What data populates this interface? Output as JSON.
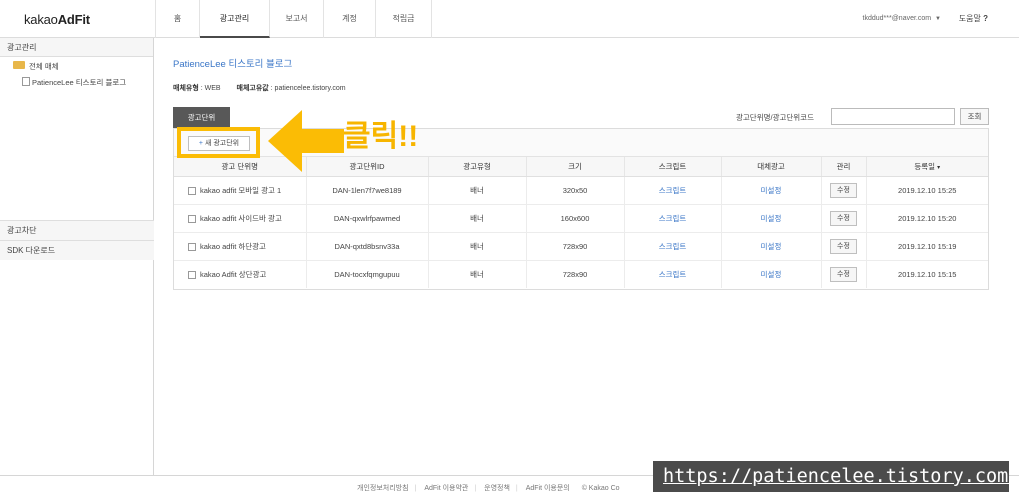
{
  "brand": {
    "prefix": "kakao",
    "name": "AdFit"
  },
  "nav": {
    "items": [
      {
        "label": "홈",
        "active": false
      },
      {
        "label": "광고관리",
        "active": true
      },
      {
        "label": "보고서",
        "active": false
      },
      {
        "label": "계정",
        "active": false
      },
      {
        "label": "적립금",
        "active": false
      }
    ]
  },
  "user": {
    "email": "tkddud***@naver.com",
    "caret": "▼",
    "help_label": "도움말",
    "help_icon": "?"
  },
  "sidebar": {
    "section_title": "광고관리",
    "tree": {
      "root_label": "전체 매체",
      "child_label": "PatienceLee 티스토리 블로그"
    },
    "menu": [
      {
        "label": "광고차단"
      },
      {
        "label": "SDK 다운로드"
      }
    ]
  },
  "main": {
    "title": "PatienceLee 티스토리 블로그",
    "meta": {
      "type_label": "매체유형",
      "type_value": ": WEB",
      "url_label": "매체고유값",
      "url_value": ": patiencelee.tistory.com"
    },
    "tab_label": "광고단위",
    "search": {
      "label": "광고단위명/광고단위코드",
      "value": "",
      "button": "조회"
    },
    "new_button": {
      "plus": "+",
      "label": "새 광고단위"
    },
    "table": {
      "headers": [
        "광고 단위명",
        "광고단위ID",
        "광고유형",
        "크기",
        "스크립트",
        "대체광고",
        "관리",
        "등록일"
      ],
      "sort_caret": "▾",
      "rows": [
        {
          "name": "kakao adfit 모바일 광고 1",
          "id": "DAN-1len7f7we8189",
          "type": "배너",
          "size": "320x50",
          "script": "스크립트",
          "alt": "미설정",
          "manage": "수정",
          "date": "2019.12.10 15:25"
        },
        {
          "name": "kakao adfit 사이드바 광고",
          "id": "DAN-qxwlrfpawmed",
          "type": "배너",
          "size": "160x600",
          "script": "스크립트",
          "alt": "미설정",
          "manage": "수정",
          "date": "2019.12.10 15:20"
        },
        {
          "name": "kakao adfit 하단광고",
          "id": "DAN-qxtd8bsnv33a",
          "type": "배너",
          "size": "728x90",
          "script": "스크립트",
          "alt": "미설정",
          "manage": "수정",
          "date": "2019.12.10 15:19"
        },
        {
          "name": "kakao Adfit 상단광고",
          "id": "DAN-tocxfqmgupuu",
          "type": "배너",
          "size": "728x90",
          "script": "스크립트",
          "alt": "미설정",
          "manage": "수정",
          "date": "2019.12.10 15:15"
        }
      ]
    }
  },
  "footer": {
    "links": [
      "개인정보처리방침",
      "AdFit 이용약관",
      "운영정책",
      "AdFit 이용문의"
    ],
    "copyright": "© Kakao Co"
  },
  "annotation": {
    "click_text": "클릭!!",
    "arrow_color": "#fbbc05",
    "watermark": "https://patiencelee.tistory.com/"
  }
}
